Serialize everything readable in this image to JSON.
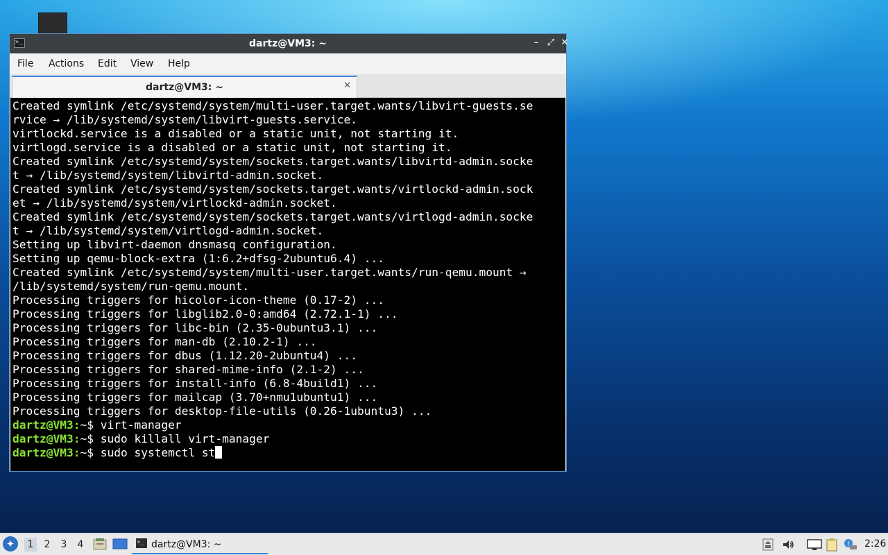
{
  "window": {
    "title": "dartz@VM3: ~",
    "menus": [
      "File",
      "Actions",
      "Edit",
      "View",
      "Help"
    ],
    "tab_title": "dartz@VM3: ~",
    "controls": {
      "minimize": "–",
      "maximize": "⤢",
      "close": "✕"
    }
  },
  "terminal": {
    "output_lines": [
      "Created symlink /etc/systemd/system/multi-user.target.wants/libvirt-guests.se",
      "rvice → /lib/systemd/system/libvirt-guests.service.",
      "virtlockd.service is a disabled or a static unit, not starting it.",
      "virtlogd.service is a disabled or a static unit, not starting it.",
      "Created symlink /etc/systemd/system/sockets.target.wants/libvirtd-admin.socke",
      "t → /lib/systemd/system/libvirtd-admin.socket.",
      "Created symlink /etc/systemd/system/sockets.target.wants/virtlockd-admin.sock",
      "et → /lib/systemd/system/virtlockd-admin.socket.",
      "Created symlink /etc/systemd/system/sockets.target.wants/virtlogd-admin.socke",
      "t → /lib/systemd/system/virtlogd-admin.socket.",
      "Setting up libvirt-daemon dnsmasq configuration.",
      "Setting up qemu-block-extra (1:6.2+dfsg-2ubuntu6.4) ...",
      "Created symlink /etc/systemd/system/multi-user.target.wants/run-qemu.mount →",
      "/lib/systemd/system/run-qemu.mount.",
      "Processing triggers for hicolor-icon-theme (0.17-2) ...",
      "Processing triggers for libglib2.0-0:amd64 (2.72.1-1) ...",
      "Processing triggers for libc-bin (2.35-0ubuntu3.1) ...",
      "Processing triggers for man-db (2.10.2-1) ...",
      "Processing triggers for dbus (1.12.20-2ubuntu4) ...",
      "Processing triggers for shared-mime-info (2.1-2) ...",
      "Processing triggers for install-info (6.8-4build1) ...",
      "Processing triggers for mailcap (3.70+nmu1ubuntu1) ...",
      "Processing triggers for desktop-file-utils (0.26-1ubuntu3) ..."
    ],
    "prompt": "dartz@VM3:",
    "prompt_suffix": "~$ ",
    "commands": [
      "virt-manager",
      "sudo killall virt-manager",
      "sudo systemctl st"
    ]
  },
  "taskbar": {
    "workspaces": [
      "1",
      "2",
      "3",
      "4"
    ],
    "active_workspace": "1",
    "task_label": "dartz@VM3: ~",
    "clock": "2:26",
    "icons": [
      "app-menu-icon",
      "file-manager-icon",
      "desktop-icon",
      "terminal-icon",
      "keyboard-icon",
      "volume-icon",
      "screen-icon",
      "clipboard-icon",
      "notification-icon"
    ]
  },
  "colors": {
    "prompt": "#8ae234",
    "titlebar": "#3b4045",
    "accent": "#3c87d6"
  }
}
